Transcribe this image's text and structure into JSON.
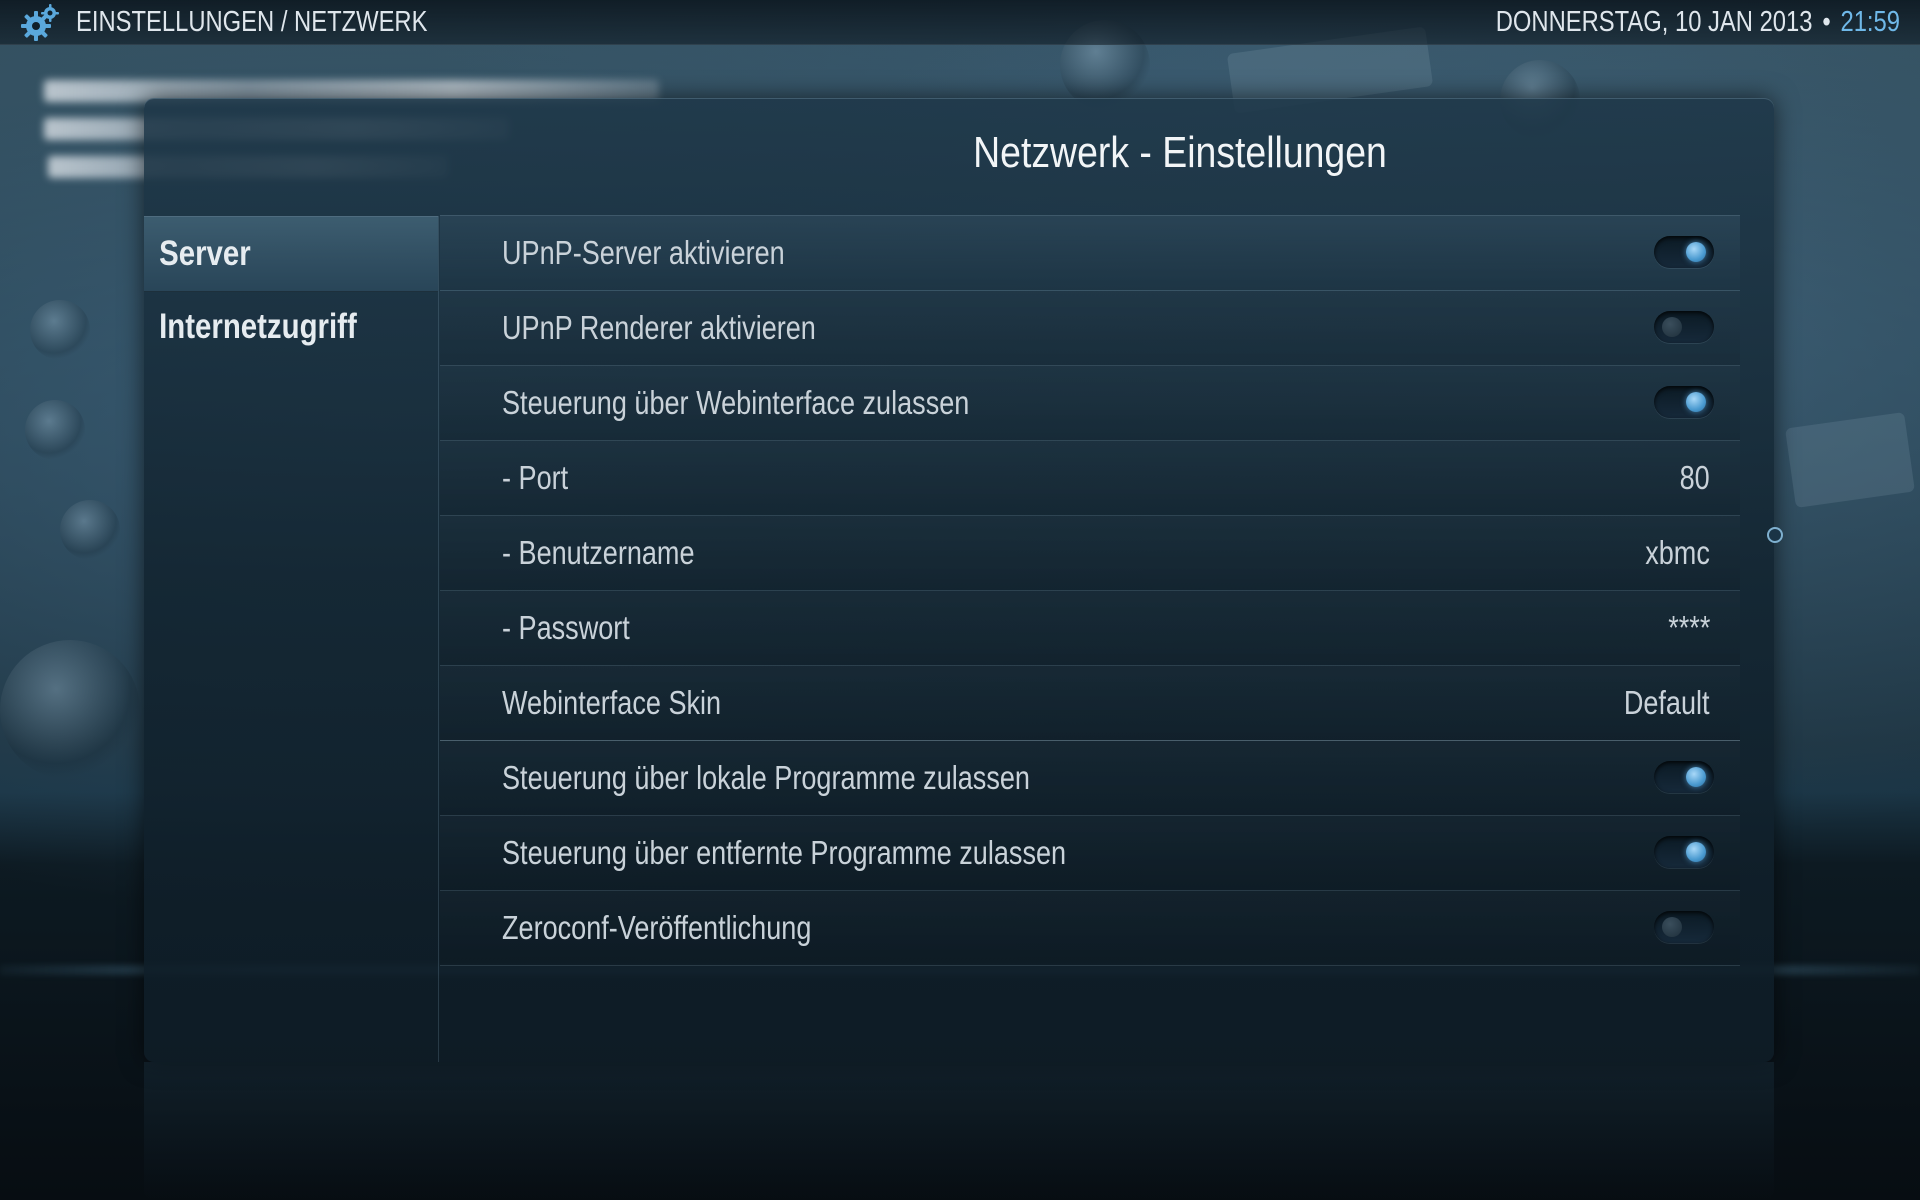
{
  "header": {
    "breadcrumb": "EINSTELLUNGEN / NETZWERK",
    "date": "DONNERSTAG, 10 JAN 2013",
    "separator": "•",
    "time": "21:59",
    "icon": "gear-icon"
  },
  "panel": {
    "title": "Netzwerk - Einstellungen"
  },
  "sidebar": {
    "items": [
      {
        "label": "Server",
        "active": true
      },
      {
        "label": "Internetzugriff",
        "active": false
      }
    ]
  },
  "settings": [
    {
      "label": "UPnP-Server aktivieren",
      "type": "toggle",
      "on": true
    },
    {
      "label": "UPnP Renderer aktivieren",
      "type": "toggle",
      "on": false
    },
    {
      "label": "Steuerung über Webinterface zulassen",
      "type": "toggle",
      "on": true
    },
    {
      "label": "- Port",
      "type": "value",
      "value": "80"
    },
    {
      "label": "- Benutzername",
      "type": "value",
      "value": "xbmc"
    },
    {
      "label": "- Passwort",
      "type": "value",
      "value": "****"
    },
    {
      "label": "Webinterface Skin",
      "type": "value",
      "value": "Default"
    },
    {
      "label": "Steuerung über lokale Programme zulassen",
      "type": "toggle",
      "on": true
    },
    {
      "label": "Steuerung über entfernte Programme zulassen",
      "type": "toggle",
      "on": true
    },
    {
      "label": "Zeroconf-Veröffentlichung",
      "type": "toggle",
      "on": false
    }
  ],
  "colors": {
    "accent": "#6fb8e8",
    "text": "#c9d2d9",
    "panel": "#142a38"
  }
}
